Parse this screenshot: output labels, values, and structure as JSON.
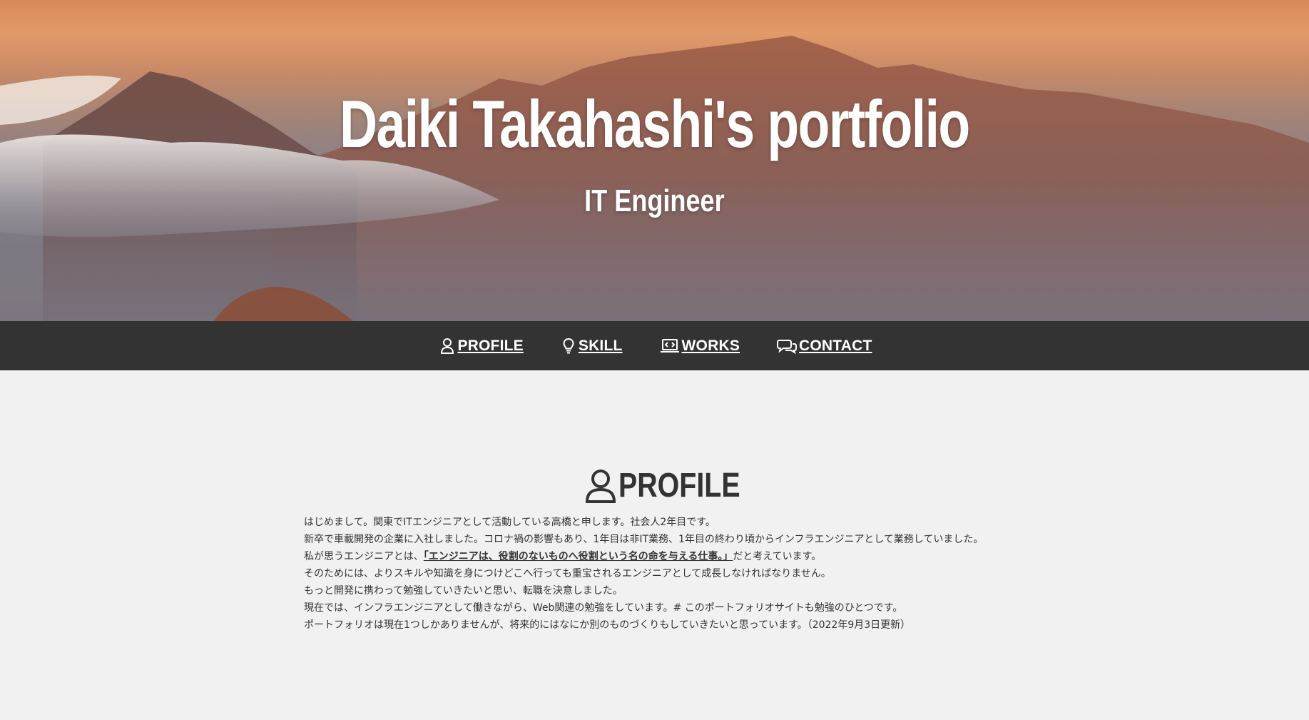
{
  "hero": {
    "title": "Daiki Takahashi's portfolio",
    "subtitle": "IT Engineer"
  },
  "nav": {
    "items": [
      {
        "label": "PROFILE",
        "icon": "person-icon"
      },
      {
        "label": "SKILL",
        "icon": "lightbulb-icon"
      },
      {
        "label": "WORKS",
        "icon": "laptop-code-icon"
      },
      {
        "label": "CONTACT",
        "icon": "chat-bubbles-icon"
      }
    ]
  },
  "profile": {
    "heading": "PROFILE",
    "heading_icon": "person-icon",
    "lines": [
      "はじめまして。関東でITエンジニアとして活動している高橋と申します。社会人2年目です。",
      "新卒で車載開発の企業に入社しました。コロナ禍の影響もあり、1年目は非IT業務、1年目の終わり頃からインフラエンジニアとして業務していました。",
      "私が思うエンジニアとは、",
      "「エンジニアは、役割のないものへ役割という名の命を与える仕事。」",
      "だと考えています。",
      "そのためには、よりスキルや知識を身につけどこへ行っても重宝されるエンジニアとして成長しなければなりません。",
      "もっと開発に携わって勉強していきたいと思い、転職を決意しました。",
      "現在では、インフラエンジニアとして働きながら、Web関連の勉強をしています。# このポートフォリオサイトも勉強のひとつです。",
      "ポートフォリオは現在1つしかありませんが、将来的にはなにか別のものづくりもしていきたいと思っています。（2022年9月3日更新）"
    ]
  },
  "colors": {
    "navbar_bg": "#333333",
    "page_bg": "#f1f1f1",
    "text": "#333333",
    "hero_text": "#ffffff"
  }
}
